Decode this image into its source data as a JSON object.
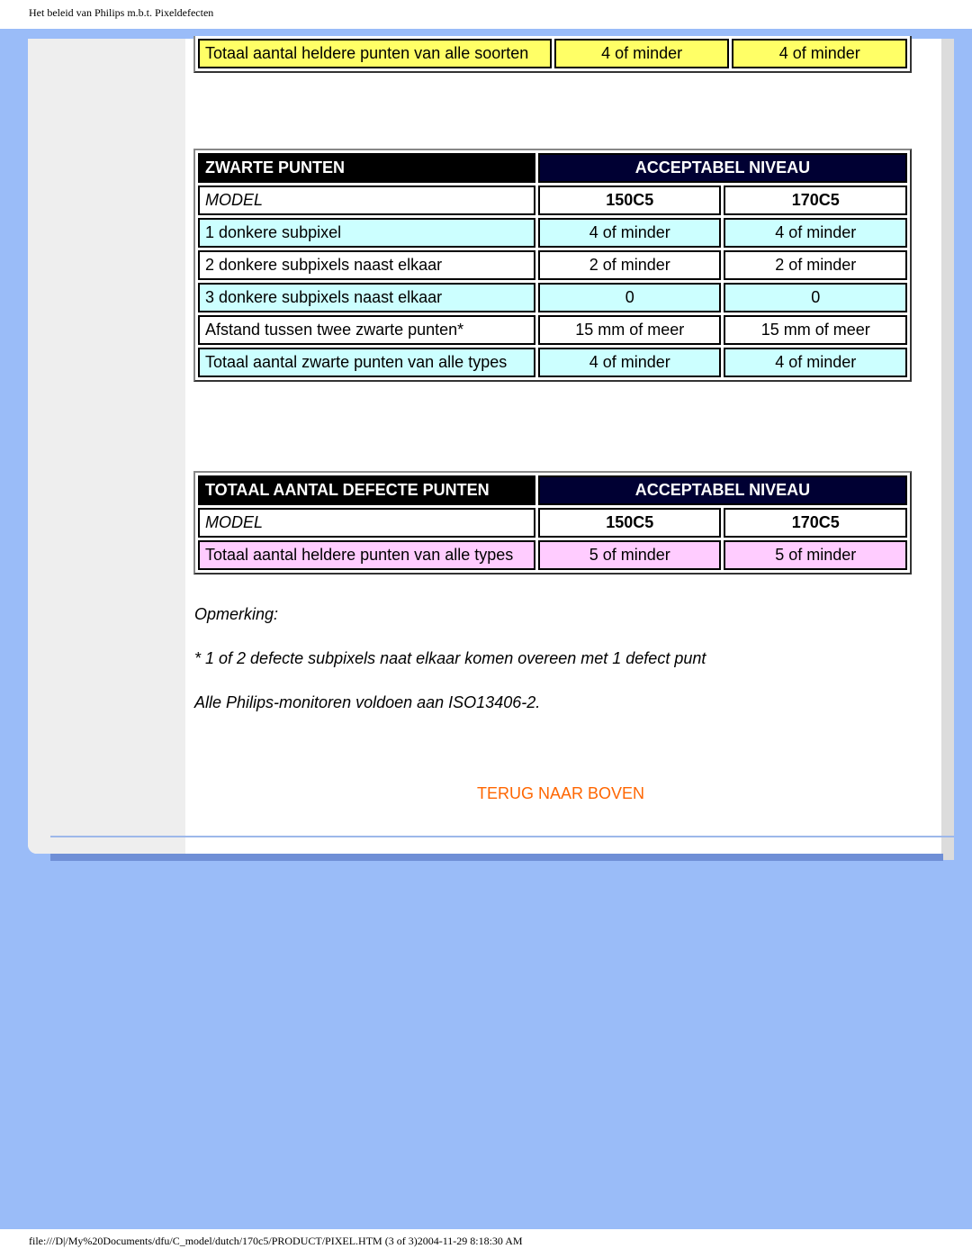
{
  "page_header": "Het beleid van Philips m.b.t. Pixeldefecten",
  "page_footer": "file:///D|/My%20Documents/dfu/C_model/dutch/170c5/PRODUCT/PIXEL.HTM (3 of 3)2004-11-29 8:18:30 AM",
  "table_bright_tail": {
    "row": [
      "Totaal aantal heldere punten van alle soorten",
      "4 of minder",
      "4 of minder"
    ]
  },
  "table_dark": {
    "header": [
      "ZWARTE PUNTEN",
      "ACCEPTABEL NIVEAU"
    ],
    "model_row": [
      "MODEL",
      "150C5",
      "170C5"
    ],
    "rows": [
      [
        "1 donkere subpixel",
        "4 of minder",
        "4 of minder"
      ],
      [
        "2 donkere subpixels naast elkaar",
        "2 of minder",
        "2 of minder"
      ],
      [
        "3 donkere subpixels naast elkaar",
        "0",
        "0"
      ],
      [
        "Afstand tussen twee zwarte punten*",
        "15 mm of meer",
        "15 mm of meer"
      ],
      [
        "Totaal aantal zwarte punten van alle types",
        "4 of minder",
        "4 of minder"
      ]
    ]
  },
  "table_total": {
    "header": [
      "TOTAAL AANTAL DEFECTE PUNTEN",
      "ACCEPTABEL NIVEAU"
    ],
    "model_row": [
      "MODEL",
      "150C5",
      "170C5"
    ],
    "rows": [
      [
        "Totaal aantal heldere punten van alle types",
        "5 of minder",
        "5 of minder"
      ]
    ]
  },
  "notes": [
    "Opmerking:",
    "* 1 of 2 defecte subpixels naat elkaar komen overeen met 1 defect punt",
    "Alle Philips-monitoren voldoen aan ISO13406-2."
  ],
  "back_to_top": "TERUG NAAR BOVEN"
}
